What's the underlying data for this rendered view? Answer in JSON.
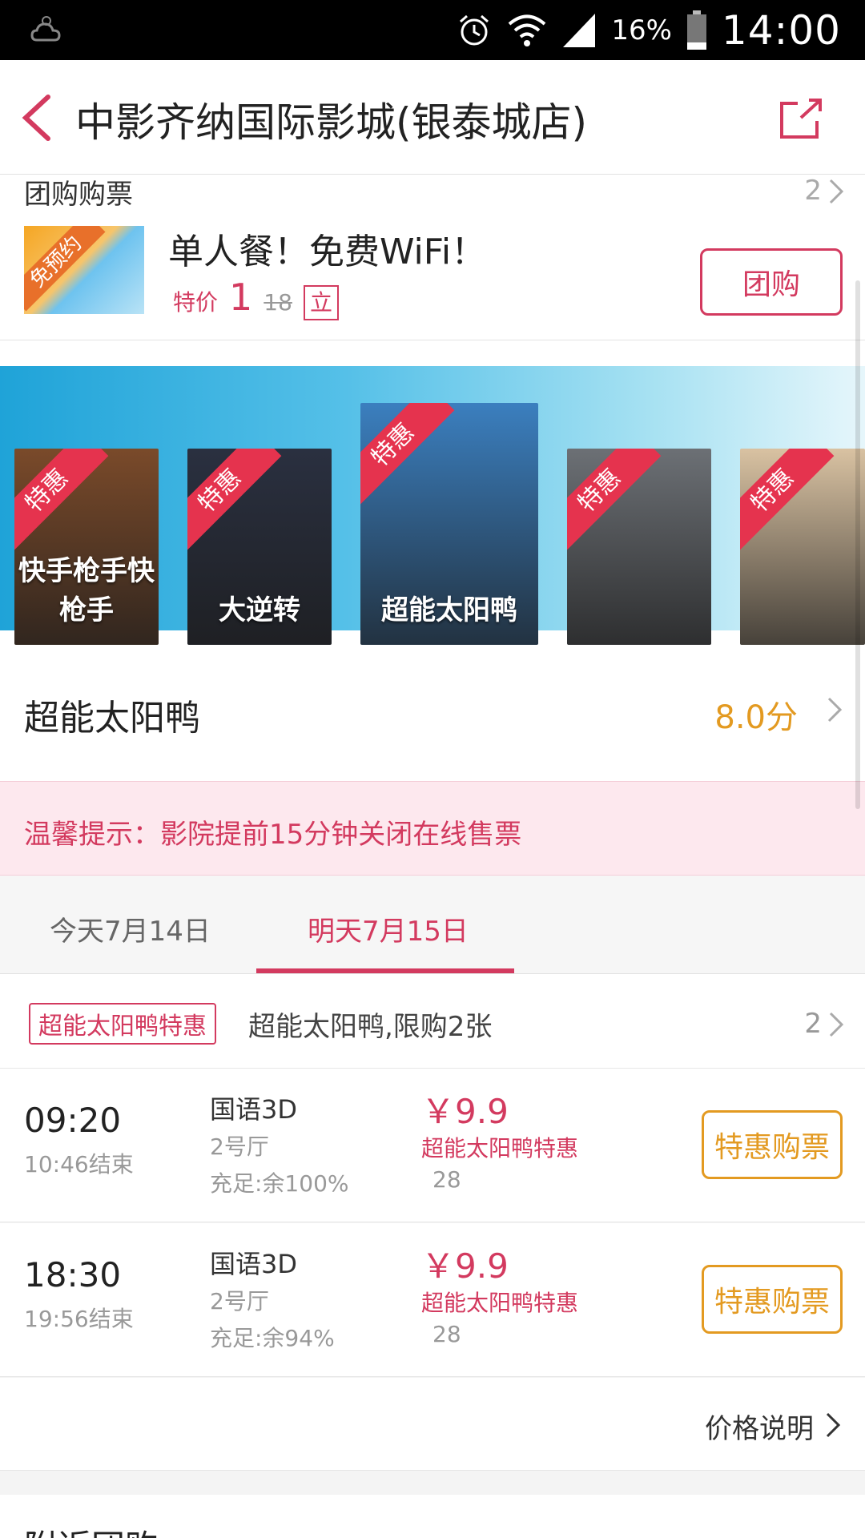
{
  "status_bar": {
    "battery": "16%",
    "time": "14:00"
  },
  "header": {
    "title": "中影齐纳国际影城(银泰城店)"
  },
  "group_buy": {
    "section_title": "团购购票",
    "count": "2",
    "thumb_badge": "免预约",
    "name": "单人餐！免费WiFi！",
    "special_label": "特价",
    "price": "1",
    "original_price": "18",
    "tag": "立",
    "button": "团购"
  },
  "carousel": {
    "colors": {
      "band": "#1fa3d8",
      "ribbon": "#e5334e"
    },
    "posters": [
      {
        "ribbon": "特惠",
        "title": "快手枪手快枪手",
        "bg": "#7a4a2a"
      },
      {
        "ribbon": "特惠",
        "title": "大逆转",
        "bg": "#2a3040"
      },
      {
        "ribbon": "特惠",
        "title": "超能太阳鸭",
        "bg": "#3b7fbf"
      },
      {
        "ribbon": "特惠",
        "title": "",
        "bg": "#6c7075"
      },
      {
        "ribbon": "特惠",
        "title": "",
        "bg": "#d9c2a2"
      }
    ]
  },
  "movie": {
    "name": "超能太阳鸭",
    "score": "8.0分"
  },
  "notice": {
    "text": "温馨提示：影院提前15分钟关闭在线售票"
  },
  "tabs": [
    {
      "label": "今天7月14日",
      "active": false
    },
    {
      "label": "明天7月15日",
      "active": true
    }
  ],
  "promo": {
    "tag": "超能太阳鸭特惠",
    "text": "超能太阳鸭,限购2张",
    "count": "2"
  },
  "showtimes": [
    {
      "time": "09:20",
      "end": "10:46结束",
      "lang": "国语3D",
      "hall": "2号厅",
      "seats": "充足:余100%",
      "price": "￥9.9",
      "promo": "超能太阳鸭特惠",
      "original": "28",
      "button": "特惠购票"
    },
    {
      "time": "18:30",
      "end": "19:56结束",
      "lang": "国语3D",
      "hall": "2号厅",
      "seats": "充足:余94%",
      "price": "￥9.9",
      "promo": "超能太阳鸭特惠",
      "original": "28",
      "button": "特惠购票"
    }
  ],
  "price_link": "价格说明",
  "nearby": {
    "title": "附近团购"
  },
  "colors": {
    "accent": "#d33a5f",
    "orange": "#e39a21",
    "notice_bg": "#fde8ee"
  }
}
